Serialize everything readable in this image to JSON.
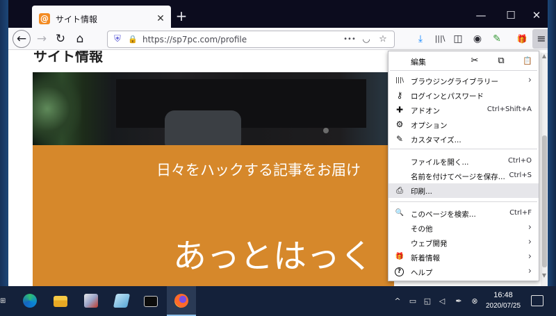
{
  "browser": {
    "tab": {
      "title": "サイト情報",
      "favicon_icon": "at-sign-icon",
      "close_glyph": "✕"
    },
    "new_tab_glyph": "+",
    "window_controls": {
      "minimize": "—",
      "maximize": "☐",
      "close": "✕"
    },
    "nav": {
      "back": "←",
      "forward": "→",
      "reload": "↻",
      "home": "⌂"
    },
    "url": "https://sp7pc.com/profile",
    "url_icons": {
      "shield": "⛨",
      "lock": "🔒",
      "more": "•••",
      "pocket": "◡",
      "bookmark": "☆"
    },
    "toolbar_icons": {
      "download": "⤓",
      "library": "|||\\",
      "sidebar": "◫",
      "account": "◉",
      "extension": "✎",
      "whatsnew": "🎁",
      "menu": "≡"
    }
  },
  "page": {
    "heading": "サイト情報",
    "hero_tagline": "日々をハックする記事をお届け",
    "hero_title": "あっとはっく",
    "accent_color": "#d6882b"
  },
  "app_menu": {
    "edit": {
      "label": "編集",
      "cut": "✂",
      "copy": "⧉",
      "paste": "📋"
    },
    "groups": [
      [
        {
          "icon": "|||\\",
          "icon_name": "library-icon",
          "label": "ブラウジングライブラリー",
          "shortcut": "",
          "submenu": true
        },
        {
          "icon": "⚷",
          "icon_name": "key-icon",
          "label": "ログインとパスワード",
          "shortcut": "",
          "submenu": false
        },
        {
          "icon": "✚",
          "icon_name": "puzzle-icon",
          "label": "アドオン",
          "shortcut": "Ctrl+Shift+A",
          "submenu": false
        },
        {
          "icon": "⚙",
          "icon_name": "gear-icon",
          "label": "オプション",
          "shortcut": "",
          "submenu": false
        },
        {
          "icon": "✎",
          "icon_name": "brush-icon",
          "label": "カスタマイズ...",
          "shortcut": "",
          "submenu": false
        }
      ],
      [
        {
          "icon": "",
          "icon_name": "",
          "label": "ファイルを開く...",
          "shortcut": "Ctrl+O",
          "submenu": false
        },
        {
          "icon": "",
          "icon_name": "",
          "label": "名前を付けてページを保存...",
          "shortcut": "Ctrl+S",
          "submenu": false
        },
        {
          "icon": "⎙",
          "icon_name": "print-icon",
          "label": "印刷...",
          "shortcut": "",
          "submenu": false
        }
      ],
      [
        {
          "icon": "🔍",
          "icon_name": "search-icon",
          "label": "このページを検索...",
          "shortcut": "Ctrl+F",
          "submenu": false
        },
        {
          "icon": "",
          "icon_name": "",
          "label": "その他",
          "shortcut": "",
          "submenu": true
        },
        {
          "icon": "",
          "icon_name": "",
          "label": "ウェブ開発",
          "shortcut": "",
          "submenu": true
        },
        {
          "icon": "🎁",
          "icon_name": "gift-icon",
          "label": "新着情報",
          "shortcut": "",
          "submenu": true
        },
        {
          "icon": "?",
          "icon_name": "help-icon",
          "label": "ヘルプ",
          "shortcut": "",
          "submenu": true
        }
      ]
    ]
  },
  "taskbar": {
    "time": "16:48",
    "date": "2020/07/25",
    "apps": [
      "edge",
      "file-explorer",
      "media-app",
      "notepad",
      "terminal",
      "firefox"
    ],
    "tray_icons": {
      "chevron": "^",
      "battery": "▭",
      "network": "◱",
      "volume": "◁",
      "pen": "✒",
      "close": "⊗"
    }
  }
}
